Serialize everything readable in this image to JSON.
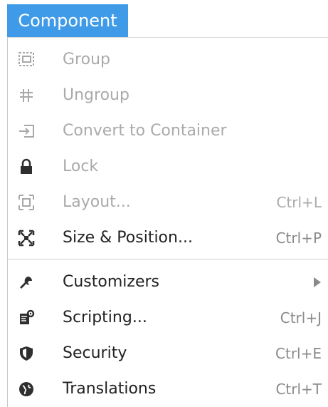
{
  "menu": {
    "title": "Component",
    "items": [
      {
        "label": "Group",
        "shortcut": "",
        "icon": "group-icon",
        "enabled": false
      },
      {
        "label": "Ungroup",
        "shortcut": "",
        "icon": "ungroup-icon",
        "enabled": false
      },
      {
        "label": "Convert to Container",
        "shortcut": "",
        "icon": "convert-to-container-icon",
        "enabled": false
      },
      {
        "label": "Lock",
        "shortcut": "",
        "icon": "lock-icon",
        "enabled": false
      },
      {
        "label": "Layout...",
        "shortcut": "Ctrl+L",
        "icon": "layout-icon",
        "enabled": false
      },
      {
        "label": "Size & Position...",
        "shortcut": "Ctrl+P",
        "icon": "size-position-icon",
        "enabled": true
      },
      {
        "label": "Customizers",
        "shortcut": "",
        "icon": "wrench-icon",
        "enabled": true,
        "submenu": true
      },
      {
        "label": "Scripting...",
        "shortcut": "Ctrl+J",
        "icon": "scripting-icon",
        "enabled": true
      },
      {
        "label": "Security",
        "shortcut": "Ctrl+E",
        "icon": "shield-icon",
        "enabled": true
      },
      {
        "label": "Translations",
        "shortcut": "Ctrl+T",
        "icon": "globe-icon",
        "enabled": true
      }
    ]
  },
  "colors": {
    "accent": "#3f9be8",
    "enabled_text": "#222222",
    "disabled_text": "#aaaaaa",
    "shortcut_text": "#8a8a8a",
    "icon_dark": "#2f2f2f",
    "icon_disabled": "#a8a8a8"
  }
}
